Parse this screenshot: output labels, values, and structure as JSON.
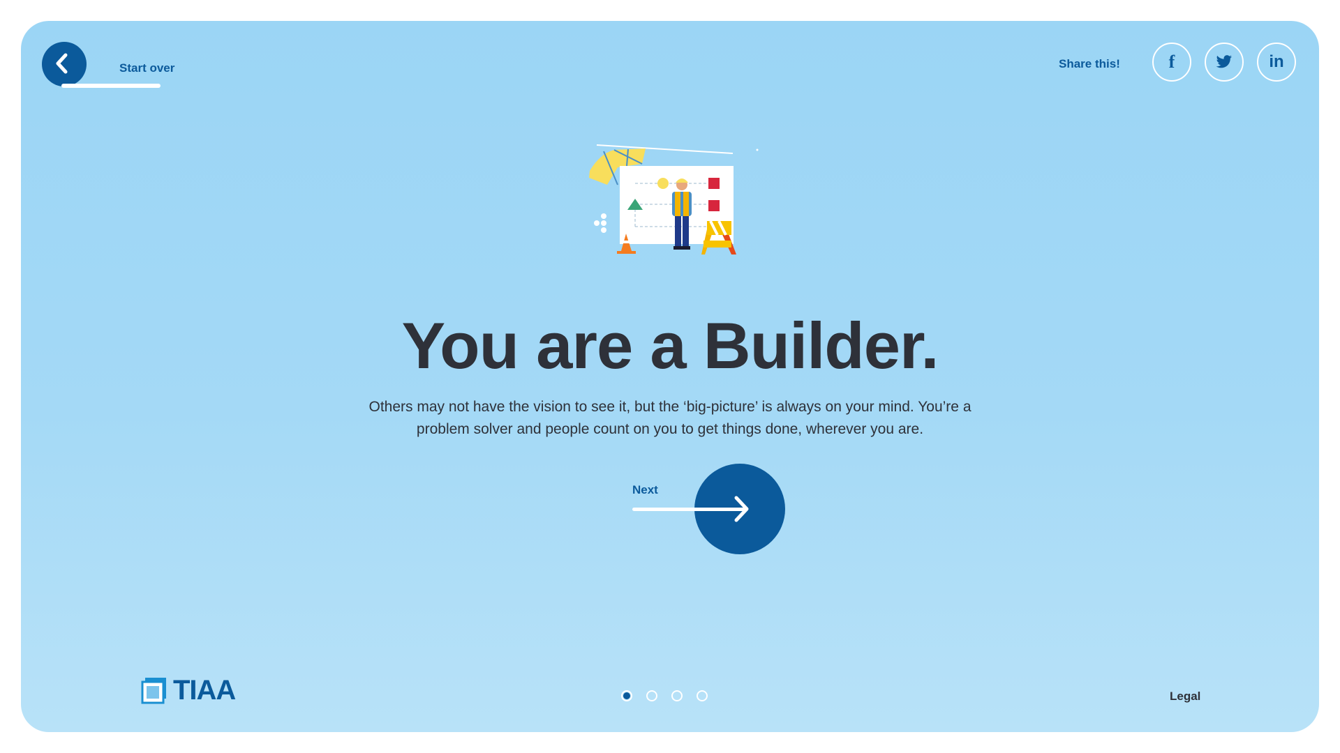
{
  "header": {
    "start_over_label": "Start over",
    "share_label": "Share this!",
    "social": [
      {
        "name": "facebook",
        "glyph": "f"
      },
      {
        "name": "twitter",
        "glyph": "twitter-bird"
      },
      {
        "name": "linkedin",
        "glyph": "in"
      }
    ]
  },
  "main": {
    "illustration": "builder-construction-icon",
    "headline": "You are a Builder.",
    "description": "Others may not have the vision to see it, but the ‘big-picture’ is always on your mind. You’re a problem solver and people count on you to get things done, wherever you are.",
    "next_label": "Next"
  },
  "footer": {
    "brand": "TIAA",
    "pagination": {
      "total": 4,
      "current": 1
    },
    "legal_label": "Legal"
  },
  "colors": {
    "brand_blue": "#0b5a9b",
    "background": "#9bd5f5",
    "text_dark": "#2e3139"
  }
}
